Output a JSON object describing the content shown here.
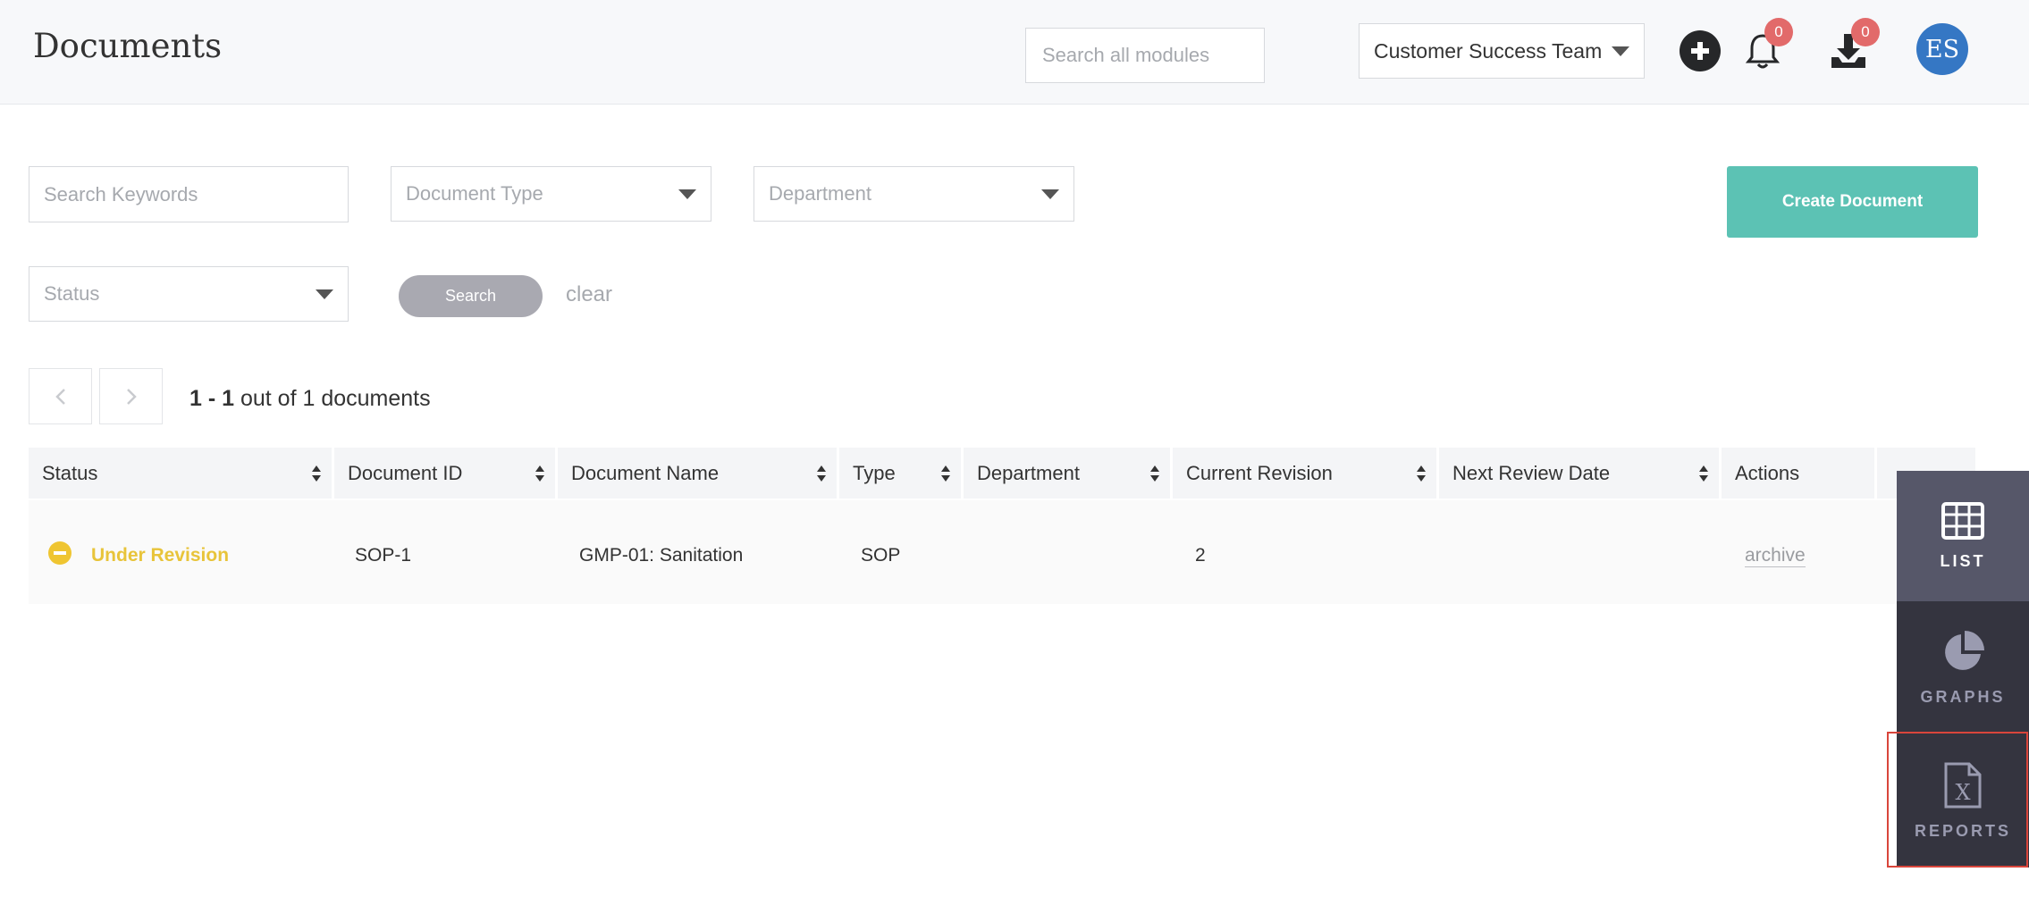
{
  "header": {
    "title": "Documents",
    "global_search_placeholder": "Search all modules",
    "team_selector": "Customer Success Team",
    "notifications_count": "0",
    "downloads_count": "0",
    "avatar_initials": "ES"
  },
  "filters": {
    "keywords_placeholder": "Search Keywords",
    "document_type": "Document Type",
    "department": "Department",
    "status": "Status",
    "search_button": "Search",
    "clear_link": "clear",
    "create_button": "Create Document"
  },
  "pagination": {
    "range": "1 - 1",
    "summary": " out of 1 documents"
  },
  "table": {
    "columns": [
      "Status",
      "Document ID",
      "Document Name",
      "Type",
      "Department",
      "Current Revision",
      "Next Review Date",
      "Actions"
    ],
    "rows": [
      {
        "status": "Under Revision",
        "document_id": "SOP-1",
        "document_name": "GMP-01: Sanitation",
        "type": "SOP",
        "department": "",
        "current_revision": "2",
        "next_review_date": "",
        "action": "archive"
      }
    ]
  },
  "side_panel": {
    "items": [
      {
        "label": "LIST",
        "icon": "table-grid-icon"
      },
      {
        "label": "GRAPHS",
        "icon": "pie-chart-icon"
      },
      {
        "label": "REPORTS",
        "icon": "excel-file-icon"
      }
    ]
  },
  "colors": {
    "accent_teal": "#5cc2b4",
    "status_yellow": "#e8c43a",
    "badge_red": "#e26a6a",
    "avatar_blue": "#3577c4",
    "side_active": "#565769",
    "side_dark": "#34343f",
    "highlight_red": "#d9453b"
  }
}
